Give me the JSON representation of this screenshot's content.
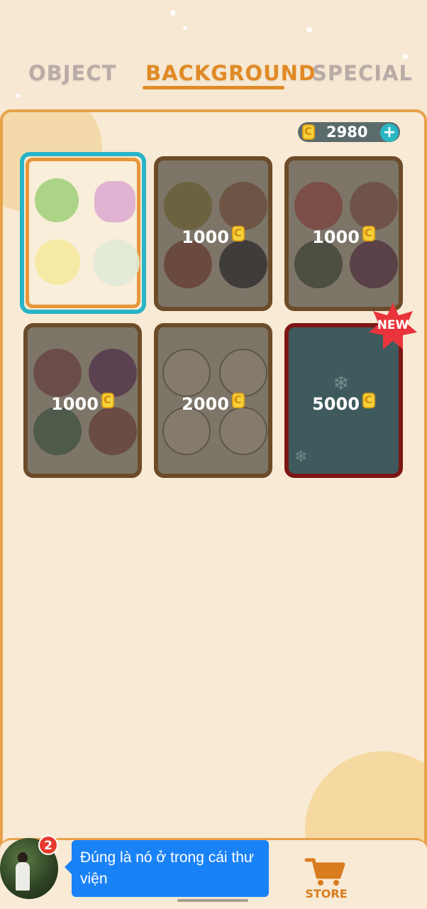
{
  "tabs": [
    {
      "label": "OBJECT"
    },
    {
      "label": "BACKGROUND",
      "active": true
    },
    {
      "label": "SPECIAL"
    }
  ],
  "coins": {
    "amount": "2980",
    "icon": "coin-icon"
  },
  "cards": [
    {
      "price": "",
      "status": "selected",
      "theme": "fruits"
    },
    {
      "price": "1000",
      "status": "locked",
      "theme": "balls"
    },
    {
      "price": "1000",
      "status": "locked",
      "theme": "candy"
    },
    {
      "price": "1000",
      "status": "locked",
      "theme": "dark-fruits"
    },
    {
      "price": "2000",
      "status": "locked",
      "theme": "cats"
    },
    {
      "price": "5000",
      "status": "locked",
      "theme": "snow",
      "badge": "NEW"
    }
  ],
  "bottom_nav": {
    "store_label": "STORE"
  },
  "chat": {
    "badge_count": "2",
    "message": "Đúng là nó ở trong cái thư viện"
  },
  "colors": {
    "accent": "#e08a25",
    "selected_border": "#29b4c7",
    "chat_bubble": "#1a82f7"
  }
}
